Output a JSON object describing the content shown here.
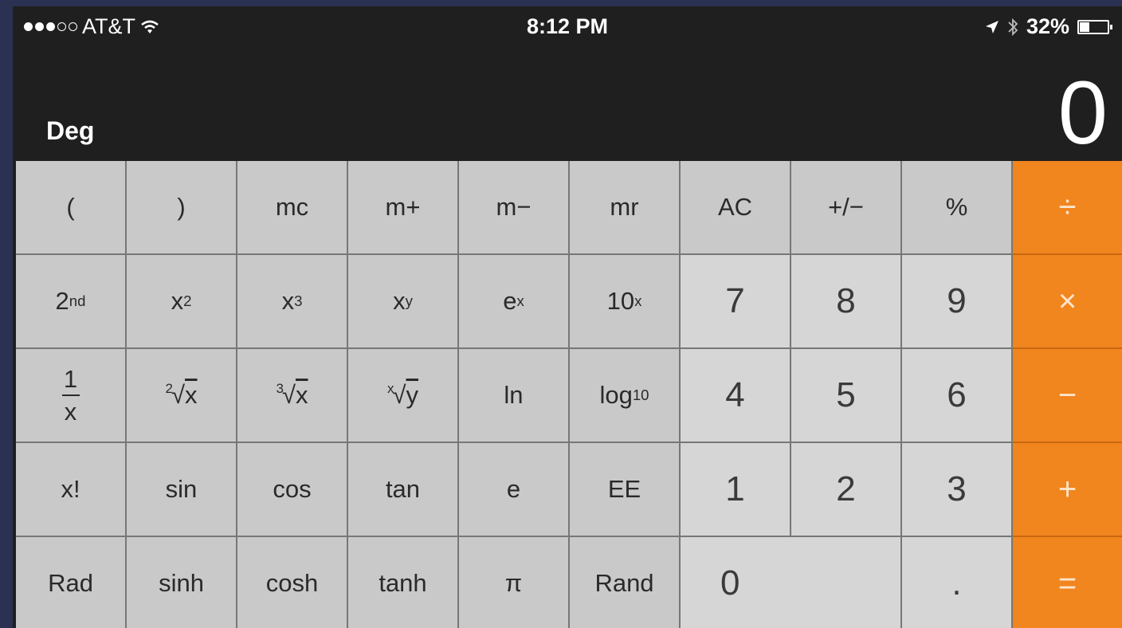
{
  "status": {
    "carrier": "AT&T",
    "time": "8:12 PM",
    "battery_percent": "32%",
    "battery_level": 0.32,
    "signal_bars_filled": 3,
    "signal_bars_total": 5
  },
  "calculator": {
    "mode": "Deg",
    "display": "0",
    "keys": {
      "open_paren": "(",
      "close_paren": ")",
      "mc": "mc",
      "m_plus": "m+",
      "m_minus": "m−",
      "mr": "mr",
      "ac": "AC",
      "plus_minus": "+/−",
      "percent": "%",
      "divide": "÷",
      "second_base": "2",
      "second_sup": "nd",
      "x_base": "x",
      "sq_sup": "2",
      "cube_sup": "3",
      "pow_sup": "y",
      "e_base": "e",
      "ex_sup": "x",
      "ten_base": "10",
      "tenx_sup": "x",
      "seven": "7",
      "eight": "8",
      "nine": "9",
      "multiply": "×",
      "frac_num": "1",
      "frac_den": "x",
      "sqrt_idx": "2",
      "sqrt_rad": "x",
      "cbrt_idx": "3",
      "cbrt_rad": "x",
      "yroot_idx": "x",
      "yroot_rad": "y",
      "ln": "ln",
      "log_base": "log",
      "log_sub": "10",
      "four": "4",
      "five": "5",
      "six": "6",
      "minus": "−",
      "factorial": "x!",
      "sin": "sin",
      "cos": "cos",
      "tan": "tan",
      "e": "e",
      "ee": "EE",
      "one": "1",
      "two": "2",
      "three": "3",
      "plus": "+",
      "rad": "Rad",
      "sinh": "sinh",
      "cosh": "cosh",
      "tanh": "tanh",
      "pi": "π",
      "rand": "Rand",
      "zero": "0",
      "decimal": ".",
      "equals": "="
    },
    "colors": {
      "operator": "#f1851e",
      "key": "#c9c9c9",
      "number_key": "#d6d6d6",
      "background": "#1f1f1f"
    }
  }
}
